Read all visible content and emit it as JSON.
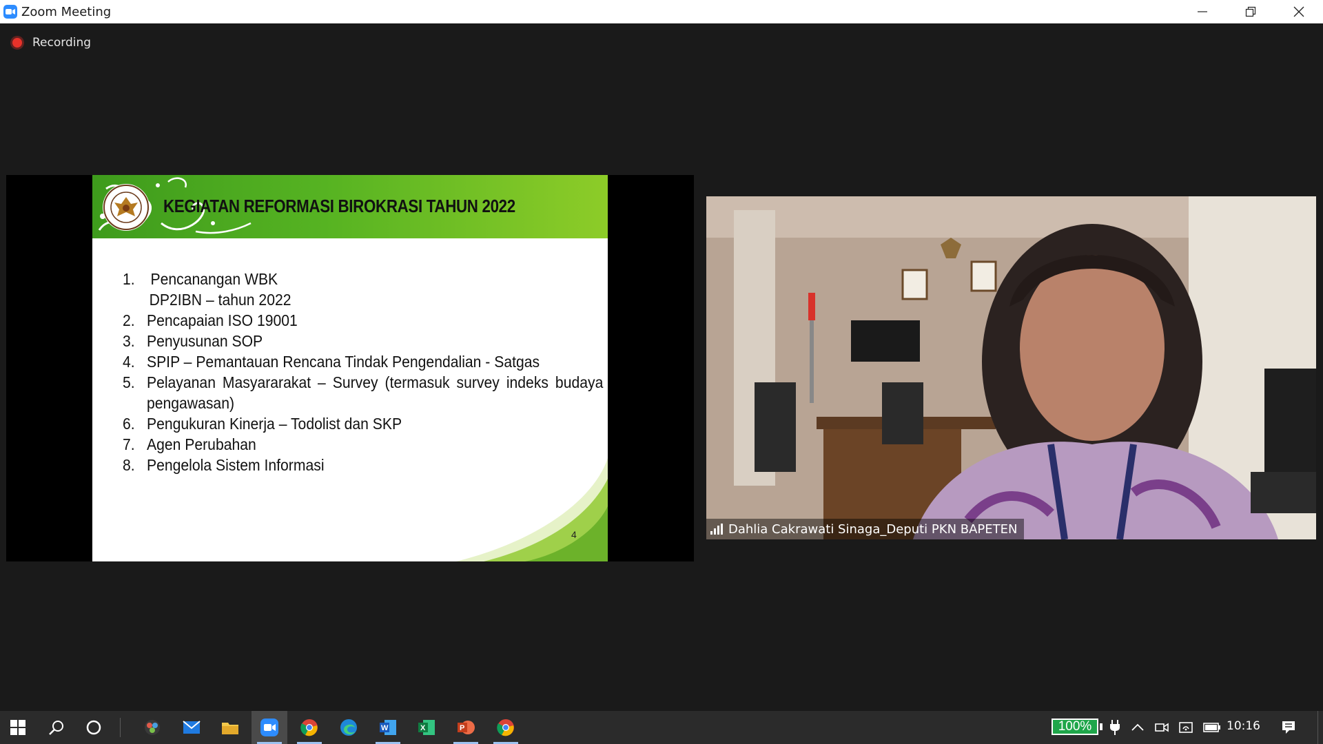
{
  "window": {
    "title": "Zoom Meeting",
    "controls": [
      "minimize-icon",
      "restore-icon",
      "close-icon"
    ]
  },
  "recording": {
    "label": "Recording",
    "color": "#e8322a"
  },
  "slide": {
    "title": "KEGIATAN REFORMASI BIROKRASI TAHUN 2022",
    "emblem_text": "BADAN PENGAWAS TENAGA NUKLIR · BAPETEN",
    "items": [
      {
        "num": "1.",
        "text": "Pencanangan WBK",
        "sub": "DP2IBN – tahun 2022"
      },
      {
        "num": "2.",
        "text": "Pencapaian ISO 19001"
      },
      {
        "num": "3.",
        "text": "Penyusunan SOP"
      },
      {
        "num": "4.",
        "text": "SPIP – Pemantauan Rencana Tindak Pengendalian - Satgas"
      },
      {
        "num": "5.",
        "text": "Pelayanan Masyararakat – Survey (termasuk survey indeks budaya pengawasan)"
      },
      {
        "num": "6.",
        "text": "Pengukuran Kinerja – Todolist dan SKP"
      },
      {
        "num": "7.",
        "text": "Agen Perubahan"
      },
      {
        "num": "8.",
        "text": "Pengelola Sistem Informasi"
      }
    ],
    "page_number": "4",
    "header_color": "#56b322"
  },
  "participant": {
    "name": "Dahlia Cakrawati Sinaga_Deputi PKN BAPETEN",
    "signal_icon": "signal-bars-icon"
  },
  "taskbar": {
    "apps": [
      "windows-start-icon",
      "search-icon",
      "cortana-icon",
      "davinci-resolve-icon",
      "mail-icon",
      "file-explorer-icon",
      "zoom-icon",
      "chrome-icon",
      "edge-icon",
      "word-icon",
      "excel-icon",
      "powerpoint-icon",
      "chrome-icon"
    ],
    "active_app": "zoom-icon",
    "battery_label": "100%",
    "time": "10:16"
  }
}
